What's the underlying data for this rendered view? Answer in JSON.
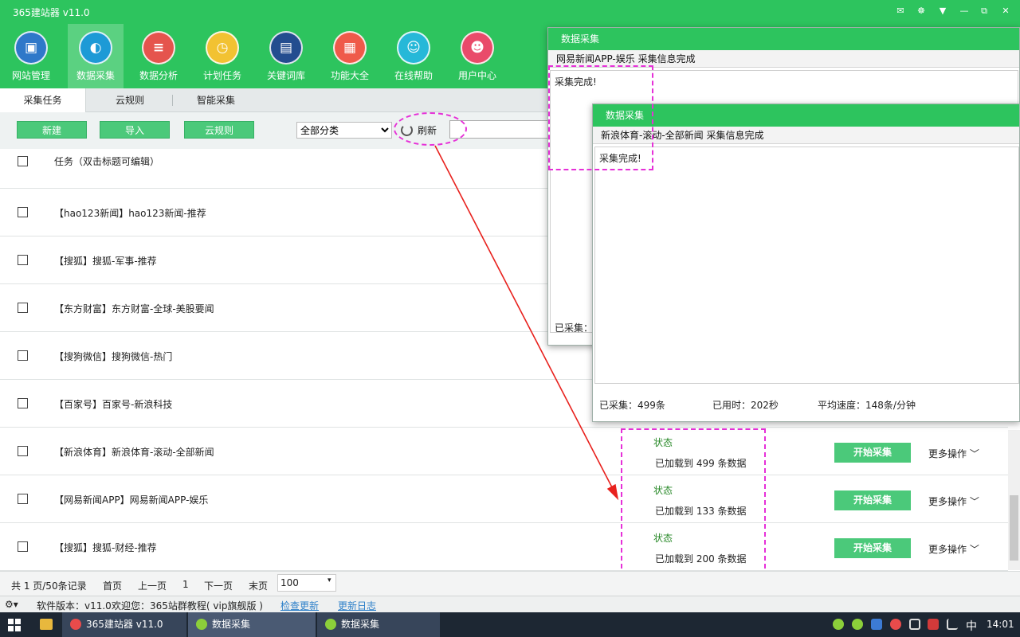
{
  "app": {
    "title": "365建站器 v11.0"
  },
  "window_controls": [
    "✉",
    "☸",
    "▼",
    "—",
    "⧉",
    "✕"
  ],
  "toolbar": [
    {
      "label": "网站管理",
      "icon": "monitor-icon",
      "color": "#2f78c9",
      "glyph": "▣"
    },
    {
      "label": "数据采集",
      "icon": "globe-icon",
      "color": "#1d9ad6",
      "glyph": "◐"
    },
    {
      "label": "数据分析",
      "icon": "database-icon",
      "color": "#e5544d",
      "glyph": "≡"
    },
    {
      "label": "计划任务",
      "icon": "clock-icon",
      "color": "#f2c232",
      "glyph": "◷"
    },
    {
      "label": "关键词库",
      "icon": "book-icon",
      "color": "#234d8f",
      "glyph": "▤"
    },
    {
      "label": "功能大全",
      "icon": "grid-icon",
      "color": "#ef5a4a",
      "glyph": "▦"
    },
    {
      "label": "在线帮助",
      "icon": "headset-icon",
      "color": "#26b8d8",
      "glyph": "☺"
    },
    {
      "label": "用户中心",
      "icon": "user-icon",
      "color": "#e94b6a",
      "glyph": "☻"
    }
  ],
  "tabs": [
    "采集任务",
    "云规则",
    "智能采集"
  ],
  "actions": {
    "new_label": "新建",
    "import_label": "导入",
    "cloud_label": "云规则",
    "category_value": "全部分类",
    "refresh_label": "刷新"
  },
  "list": {
    "header": "任务（双击标题可编辑）",
    "rows": [
      {
        "name": "【hao123新闻】hao123新闻-推荐"
      },
      {
        "name": "【搜狐】搜狐-军事-推荐"
      },
      {
        "name": "【东方财富】东方财富-全球-美股要闻"
      },
      {
        "name": "【搜狗微信】搜狗微信-热门"
      },
      {
        "name": "【百家号】百家号-新浪科技"
      },
      {
        "name": "【新浪体育】新浪体育-滚动-全部新闻",
        "status_label": "状态",
        "status_text": "已加载到 499 条数据",
        "start_label": "开始采集",
        "more_label": "更多操作"
      },
      {
        "name": "【网易新闻APP】网易新闻APP-娱乐",
        "status_label": "状态",
        "status_text": "已加载到 133 条数据",
        "start_label": "开始采集",
        "more_label": "更多操作"
      },
      {
        "name": "【搜狐】搜狐-财经-推荐",
        "status_label": "状态",
        "status_text": "已加载到 200 条数据",
        "start_label": "开始采集",
        "more_label": "更多操作"
      }
    ]
  },
  "pager": {
    "summary": "共 1 页/50条记录",
    "first": "首页",
    "prev": "上一页",
    "current": "1",
    "next": "下一页",
    "last": "末页",
    "page_size": "100"
  },
  "statusbar": {
    "version": "软件版本：v11.0",
    "welcome": "欢迎您：365站群教程( vip旗舰版 )",
    "check_update": "检查更新",
    "changelog": "更新日志"
  },
  "dialog1": {
    "title": "数据采集",
    "subtitle": "网易新闻APP-娱乐 采集信息完成",
    "log": "采集完成!",
    "collected": "已采集："
  },
  "dialog2": {
    "title": "数据采集",
    "subtitle": "新浪体育-滚动-全部新闻 采集信息完成",
    "log": "采集完成!",
    "collected": "已采集：499条",
    "elapsed": "已用时：202秒",
    "speed": "平均速度：148条/分钟"
  },
  "taskbar": {
    "items": [
      "365建站器 v11.0",
      "数据采集",
      "数据采集"
    ],
    "ime": "中",
    "clock": "14:01"
  },
  "colors": {
    "brand": "#2dc45e",
    "button": "#4bc97a",
    "annotation": "#e630d8",
    "arrow": "#e8211d"
  }
}
